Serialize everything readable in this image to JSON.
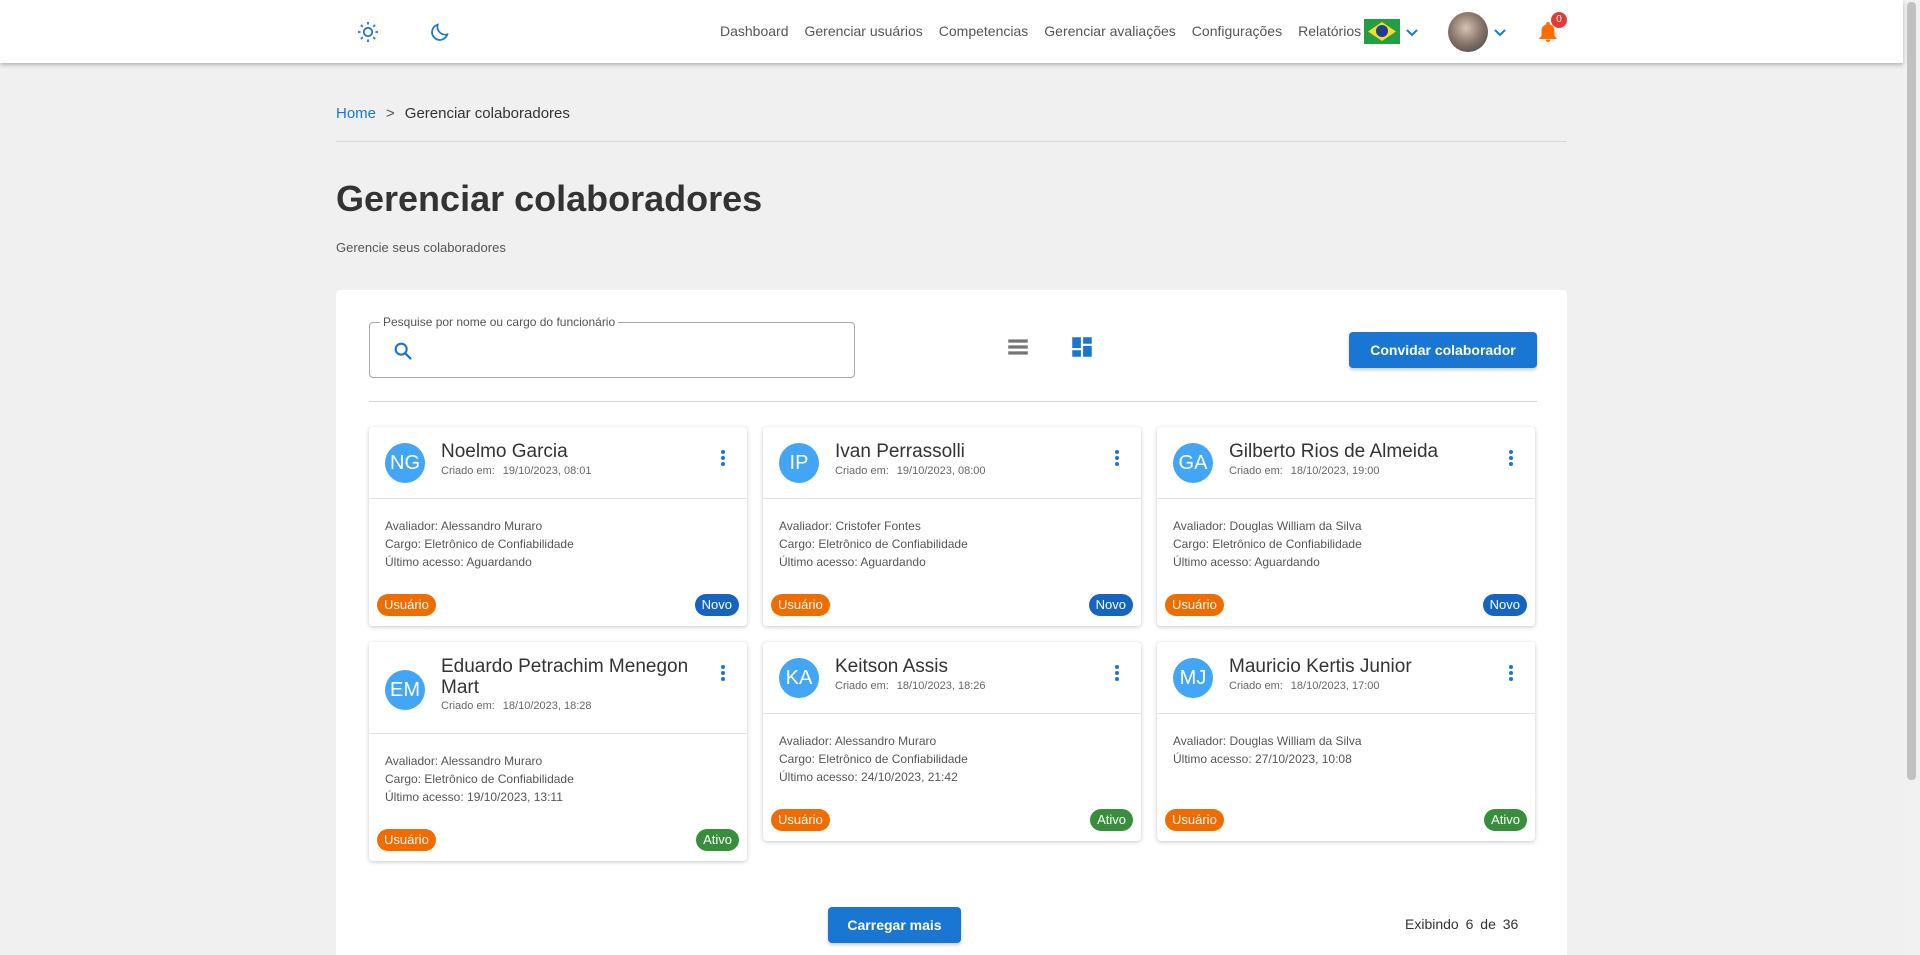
{
  "header": {
    "nav": [
      "Dashboard",
      "Gerenciar usuários",
      "Competencias",
      "Gerenciar avaliações",
      "Configurações",
      "Relatórios"
    ],
    "notification_count": "0",
    "icons": {
      "light_theme": "sun-icon",
      "dark_theme": "moon-icon",
      "language": "brazil-flag-icon",
      "notifications": "bell-icon"
    },
    "colors": {
      "accent": "#1976d2",
      "bell": "#ff6d00",
      "badge": "#e53935"
    }
  },
  "breadcrumb": {
    "home": "Home",
    "separator": ">",
    "current": "Gerenciar colaboradores"
  },
  "page": {
    "title": "Gerenciar colaboradores",
    "subtitle": "Gerencie seus colaboradores"
  },
  "toolbar": {
    "search_label": "Pesquise por nome ou cargo do funcionário",
    "search_value": "",
    "invite_label": "Convidar colaborador",
    "view_modes": [
      "list-view-icon",
      "grid-view-icon"
    ],
    "active_view": "grid-view-icon"
  },
  "cards": [
    {
      "initials": "NG",
      "name": "Noelmo Garcia",
      "created_label": "Criado em:",
      "created": "19/10/2023, 08:01",
      "lines": [
        "Avaliador: Alessandro Muraro",
        "Cargo: Eletrônico de Confiabilidade",
        "Último acesso: Aguardando"
      ],
      "role": "Usuário",
      "status": "Novo",
      "status_color": "#1565c0"
    },
    {
      "initials": "IP",
      "name": "Ivan Perrassolli",
      "created_label": "Criado em:",
      "created": "19/10/2023, 08:00",
      "lines": [
        "Avaliador: Cristofer Fontes",
        "Cargo: Eletrônico de Confiabilidade",
        "Último acesso: Aguardando"
      ],
      "role": "Usuário",
      "status": "Novo",
      "status_color": "#1565c0"
    },
    {
      "initials": "GA",
      "name": "Gilberto Rios de Almeida",
      "created_label": "Criado em:",
      "created": "18/10/2023, 19:00",
      "lines": [
        "Avaliador: Douglas William da Silva",
        "Cargo: Eletrônico de Confiabilidade",
        "Último acesso: Aguardando"
      ],
      "role": "Usuário",
      "status": "Novo",
      "status_color": "#1565c0"
    },
    {
      "initials": "EM",
      "name": "Eduardo Petrachim Menegon Mart",
      "created_label": "Criado em:",
      "created": "18/10/2023, 18:28",
      "lines": [
        "Avaliador: Alessandro Muraro",
        "Cargo: Eletrônico de Confiabilidade",
        "Último acesso: 19/10/2023, 13:11"
      ],
      "role": "Usuário",
      "status": "Ativo",
      "status_color": "#388e3c"
    },
    {
      "initials": "KA",
      "name": "Keitson Assis",
      "created_label": "Criado em:",
      "created": "18/10/2023, 18:26",
      "lines": [
        "Avaliador: Alessandro Muraro",
        "Cargo: Eletrônico de Confiabilidade",
        "Último acesso: 24/10/2023, 21:42"
      ],
      "role": "Usuário",
      "status": "Ativo",
      "status_color": "#388e3c"
    },
    {
      "initials": "MJ",
      "name": "Mauricio Kertis Junior",
      "created_label": "Criado em:",
      "created": "18/10/2023, 17:00",
      "lines": [
        "Avaliador: Douglas William da Silva",
        "Último acesso: 27/10/2023, 10:08"
      ],
      "role": "Usuário",
      "status": "Ativo",
      "status_color": "#388e3c"
    }
  ],
  "pagination": {
    "load_more": "Carregar mais",
    "showing_label": "Exibindo",
    "shown": "6",
    "of_label": "de",
    "total": "36"
  },
  "colors": {
    "role_badge": "#ef6c00",
    "avatar": "#42a5f5",
    "background": "#f0f0f0"
  }
}
